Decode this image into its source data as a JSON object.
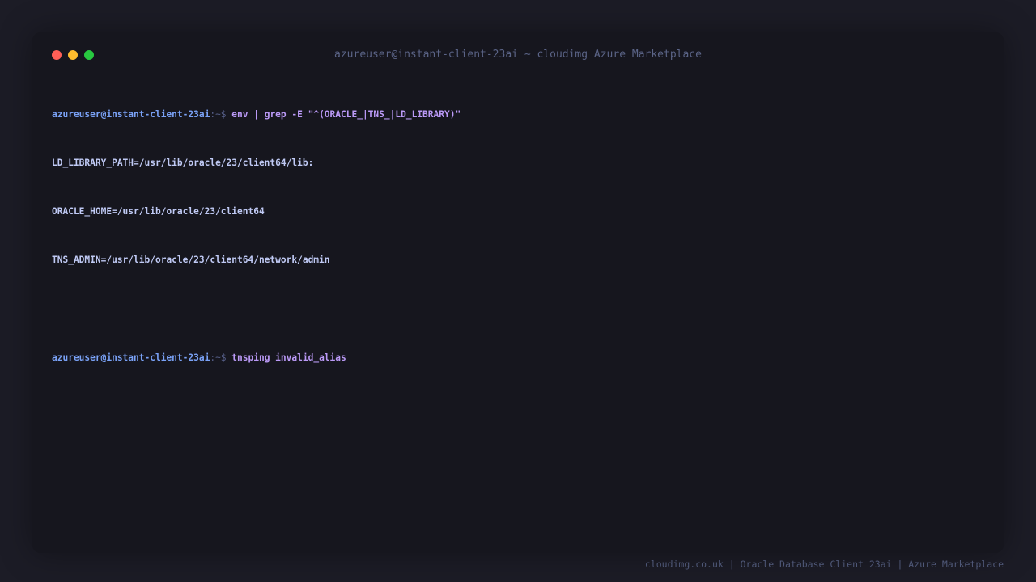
{
  "window": {
    "title": "azureuser@instant-client-23ai ~ cloudimg Azure Marketplace"
  },
  "terminal": {
    "lines": [
      {
        "prompt_user": "azureuser@instant-client-23ai",
        "prompt_sep": ":~$",
        "command": "env | grep -E \"^(ORACLE_|TNS_|LD_LIBRARY)\""
      },
      {
        "output": "LD_LIBRARY_PATH=/usr/lib/oracle/23/client64/lib:"
      },
      {
        "output": "ORACLE_HOME=/usr/lib/oracle/23/client64"
      },
      {
        "output": "TNS_ADMIN=/usr/lib/oracle/23/client64/network/admin"
      },
      {
        "output": ""
      },
      {
        "prompt_user": "azureuser@instant-client-23ai",
        "prompt_sep": ":~$",
        "command": "tnsping invalid_alias"
      }
    ]
  },
  "footer": {
    "text": "cloudimg.co.uk | Oracle Database Client 23ai | Azure Marketplace"
  },
  "colors": {
    "background": "#1c1c26",
    "window_bg": "#16161e",
    "prompt": "#7aa2f7",
    "command": "#bb9af7",
    "output": "#c0caf5",
    "close": "#ff5f57",
    "minimize": "#febc2e",
    "maximize": "#28c840"
  }
}
